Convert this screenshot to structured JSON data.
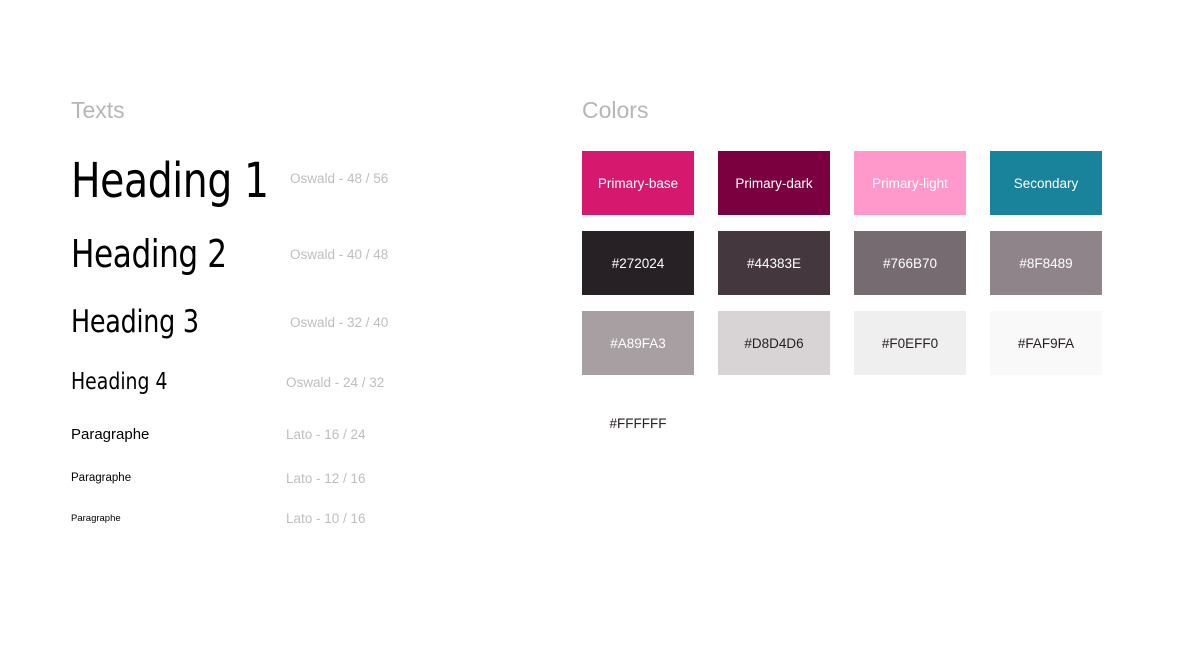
{
  "texts": {
    "title": "Texts",
    "samples": [
      {
        "label": "Heading 1",
        "spec": "Oswald - 48 / 56"
      },
      {
        "label": "Heading 2",
        "spec": "Oswald - 40 / 48"
      },
      {
        "label": "Heading 3",
        "spec": "Oswald - 32 / 40"
      },
      {
        "label": "Heading 4",
        "spec": "Oswald - 24 / 32"
      },
      {
        "label": "Paragraphe",
        "spec": "Lato - 16 / 24"
      },
      {
        "label": "Paragraphe",
        "spec": "Lato - 12 / 16"
      },
      {
        "label": "Paragraphe",
        "spec": "Lato - 10 / 16"
      }
    ]
  },
  "colors": {
    "title": "Colors",
    "swatches": [
      {
        "label": "Primary-base",
        "color": "#D6186F",
        "text_color": "#FFFFFF"
      },
      {
        "label": "Primary-dark",
        "color": "#7A0040",
        "text_color": "#FFFFFF"
      },
      {
        "label": "Primary-light",
        "color": "#FF99CC",
        "text_color": "#FFFFFF"
      },
      {
        "label": "Secondary",
        "color": "#18839A",
        "text_color": "#FFFFFF"
      },
      {
        "label": "#272024",
        "color": "#272024",
        "text_color": "#FFFFFF"
      },
      {
        "label": "#44383E",
        "color": "#44383E",
        "text_color": "#FFFFFF"
      },
      {
        "label": "#766B70",
        "color": "#766B70",
        "text_color": "#FFFFFF"
      },
      {
        "label": "#8F8489",
        "color": "#8F8489",
        "text_color": "#FFFFFF"
      },
      {
        "label": "#A89FA3",
        "color": "#A89FA3",
        "text_color": "#FFFFFF"
      },
      {
        "label": "#D8D4D6",
        "color": "#D8D4D6",
        "text_color": "#272024"
      },
      {
        "label": "#F0EFF0",
        "color": "#F0EFF0",
        "text_color": "#272024"
      },
      {
        "label": "#FAF9FA",
        "color": "#FAF9FA",
        "text_color": "#272024"
      },
      {
        "label": "#FFFFFF",
        "color": "#FFFFFF",
        "text_color": "#272024"
      }
    ]
  }
}
